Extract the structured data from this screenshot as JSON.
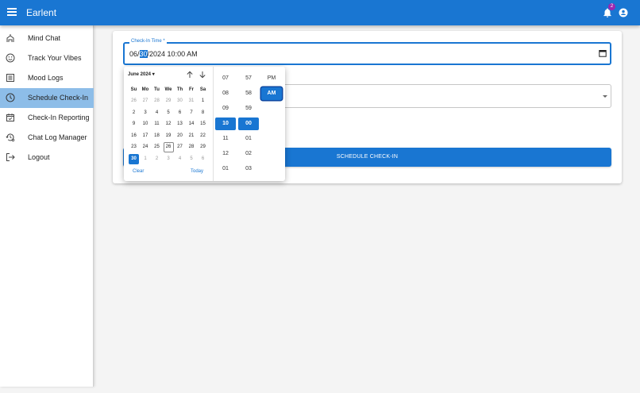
{
  "app": {
    "title": "Earlent",
    "notification_count": "2"
  },
  "sidebar": {
    "items": [
      {
        "label": "Mind Chat",
        "icon": "mind-chat-icon"
      },
      {
        "label": "Track Your Vibes",
        "icon": "smiley-icon"
      },
      {
        "label": "Mood Logs",
        "icon": "list-icon"
      },
      {
        "label": "Schedule Check-In",
        "icon": "clock-icon",
        "active": true
      },
      {
        "label": "Check-In Reporting",
        "icon": "calendar-check-icon"
      },
      {
        "label": "Chat Log Manager",
        "icon": "manage-history-icon"
      },
      {
        "label": "Logout",
        "icon": "logout-icon"
      }
    ]
  },
  "form": {
    "checkin_label": "Check-In Time *",
    "checkin_value_pre": "06/",
    "checkin_value_sel": "30",
    "checkin_value_post": "/2024 10:00 AM",
    "submit_label": "SCHEDULE CHECK-IN"
  },
  "picker": {
    "month_label": "June 2024",
    "weekdays": [
      "Su",
      "Mo",
      "Tu",
      "We",
      "Th",
      "Fr",
      "Sa"
    ],
    "weeks": [
      [
        "26",
        "27",
        "28",
        "29",
        "30",
        "31",
        "1"
      ],
      [
        "2",
        "3",
        "4",
        "5",
        "6",
        "7",
        "8"
      ],
      [
        "9",
        "10",
        "11",
        "12",
        "13",
        "14",
        "15"
      ],
      [
        "16",
        "17",
        "18",
        "19",
        "20",
        "21",
        "22"
      ],
      [
        "23",
        "24",
        "25",
        "26",
        "27",
        "28",
        "29"
      ],
      [
        "30",
        "1",
        "2",
        "3",
        "4",
        "5",
        "6"
      ]
    ],
    "selected_day": "30",
    "today": "26",
    "clear_label": "Clear",
    "today_label": "Today",
    "hours": [
      "07",
      "08",
      "09",
      "10",
      "11",
      "12",
      "01"
    ],
    "minutes": [
      "57",
      "58",
      "59",
      "00",
      "01",
      "02",
      "03"
    ],
    "meridiem": [
      "PM",
      "AM"
    ],
    "selected_hour": "10",
    "selected_minute": "00",
    "selected_meridiem": "AM"
  },
  "colors": {
    "primary": "#1976d2",
    "active_nav": "#8dbde8",
    "badge": "#9c27b0"
  }
}
